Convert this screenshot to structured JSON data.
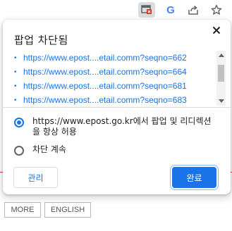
{
  "toolbar": {
    "icons": [
      "popup-blocked-icon",
      "google-icon",
      "share-icon",
      "star-icon"
    ],
    "google_letter": "G"
  },
  "dialog": {
    "title": "팝업 차단됨",
    "urls": [
      "https://www.epost....etail.comm?seqno=662",
      "https://www.epost....etail.comm?seqno=664",
      "https://www.epost....etail.comm?seqno=681",
      "https://www.epost....etail.comm?seqno=683"
    ],
    "bullet": "•",
    "options": [
      {
        "label": "https://www.epost.go.kr에서 팝업 및 리디렉션을 항상 허용",
        "checked": true
      },
      {
        "label": "차단 계속",
        "checked": false
      }
    ],
    "manage_label": "관리",
    "done_label": "완료"
  },
  "page": {
    "buttons": [
      "MORE",
      "ENGLISH"
    ]
  },
  "colors": {
    "accent": "#1a73e8",
    "page_rule": "#d93025"
  }
}
